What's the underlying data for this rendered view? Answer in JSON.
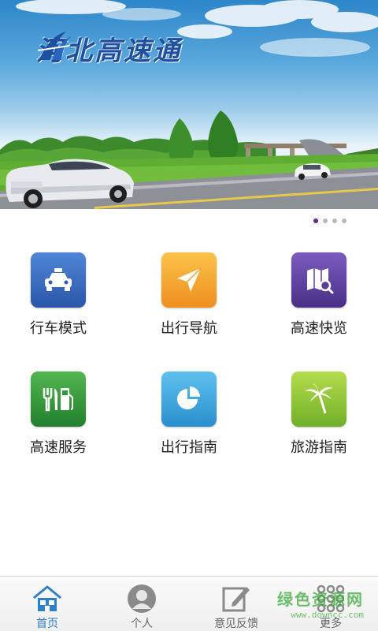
{
  "banner": {
    "title": "河北高速通",
    "pager": {
      "count": 4,
      "active_index": 0
    }
  },
  "grid": {
    "items": [
      {
        "label": "行车模式",
        "icon": "car-icon",
        "color": "#2f5fb4"
      },
      {
        "label": "出行导航",
        "icon": "navigation-arrow-icon",
        "color": "#f1a12a"
      },
      {
        "label": "高速快览",
        "icon": "map-search-icon",
        "color": "#5a3d9a"
      },
      {
        "label": "高速服务",
        "icon": "service-fuel-icon",
        "color": "#2f9a3c"
      },
      {
        "label": "出行指南",
        "icon": "pie-chart-icon",
        "color": "#3aa2dc"
      },
      {
        "label": "旅游指南",
        "icon": "palm-tree-icon",
        "color": "#8cc63e"
      }
    ]
  },
  "tabbar": {
    "items": [
      {
        "label": "首页",
        "icon": "home-icon",
        "active": true
      },
      {
        "label": "个人",
        "icon": "person-icon",
        "active": false
      },
      {
        "label": "意见反馈",
        "icon": "feedback-edit-icon",
        "active": false
      },
      {
        "label": "更多",
        "icon": "more-grid-icon",
        "active": false
      }
    ]
  },
  "watermark": {
    "line1": "绿色资源网",
    "line2": "www.downcc.com"
  }
}
